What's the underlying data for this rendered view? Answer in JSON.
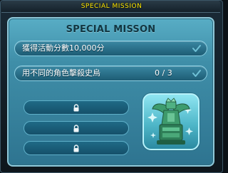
{
  "window": {
    "title": "SPECIAL MISSION"
  },
  "panel": {
    "header": "SPECIAL MISSON"
  },
  "missions": [
    {
      "text": "獲得活動分數10,000分",
      "progress": ""
    },
    {
      "text": "用不同的角色擊殺史烏",
      "progress": "0 / 3"
    }
  ],
  "locked_slots": 3,
  "reward": {
    "icon": "green-statue-reward-icon"
  },
  "colors": {
    "title_yellow": "#ffe800",
    "panel_blue": "#3f8ea8",
    "header_text": "#123540"
  }
}
